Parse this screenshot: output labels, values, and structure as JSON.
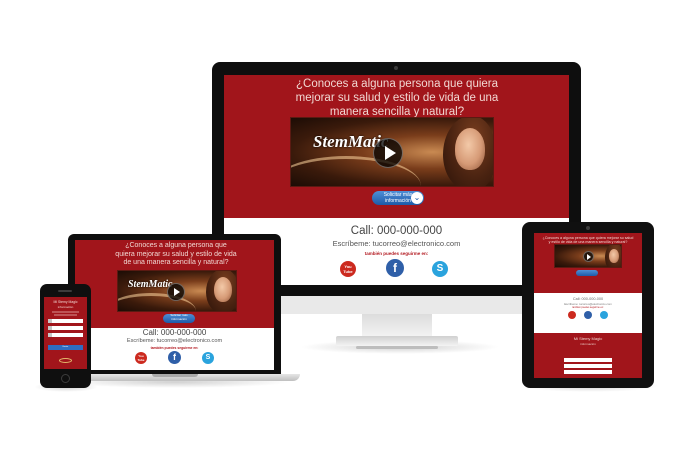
{
  "desktop": {
    "question": "¿Conoces a alguna persona que quiera mejorar su salud y estilo de vida de una manera sencilla y natural?",
    "video_logo": "StemMatic",
    "cta_label": "Solicitar más información",
    "call": "Call: 000-000-000",
    "write": "Escríbeme: tucorreo@electronico.com",
    "follow": "también puedes seguirme en:",
    "social": {
      "youtube": "You Tube",
      "facebook": "f",
      "skype": "S"
    }
  },
  "laptop": {
    "question": "¿Conoces a alguna persona que quiera mejorar su salud y estilo de vida de una manera sencilla y natural?",
    "video_logo": "StemMatic",
    "cta_label": "Solicitar más información",
    "call": "Call: 000-000-000",
    "write": "Escríbeme: tucorreo@electronico.com",
    "follow": "también puedes seguirme en:",
    "social": {
      "youtube": "You Tube",
      "facebook": "f",
      "skype": "S"
    }
  },
  "tablet": {
    "question": "¿Conoces a alguna persona que quiera mejorar su salud y estilo de vida de una manera sencilla y natural?",
    "call": "Call: 000-000-000",
    "write": "Escríbeme: tucorreo@electronico.com",
    "follow": "también puedes seguirme en:",
    "brand": "Mi Stemy Magic",
    "brand_sub": "información"
  },
  "phone": {
    "brand": "Mi Stemy Magic",
    "brand_sub": "información",
    "button": "Enviar"
  },
  "colors": {
    "brand_red": "#a1151b",
    "cta_blue": "#1d5aa8",
    "youtube": "#cc2a1f",
    "facebook": "#2f5fa8",
    "skype": "#2aa3dd"
  }
}
